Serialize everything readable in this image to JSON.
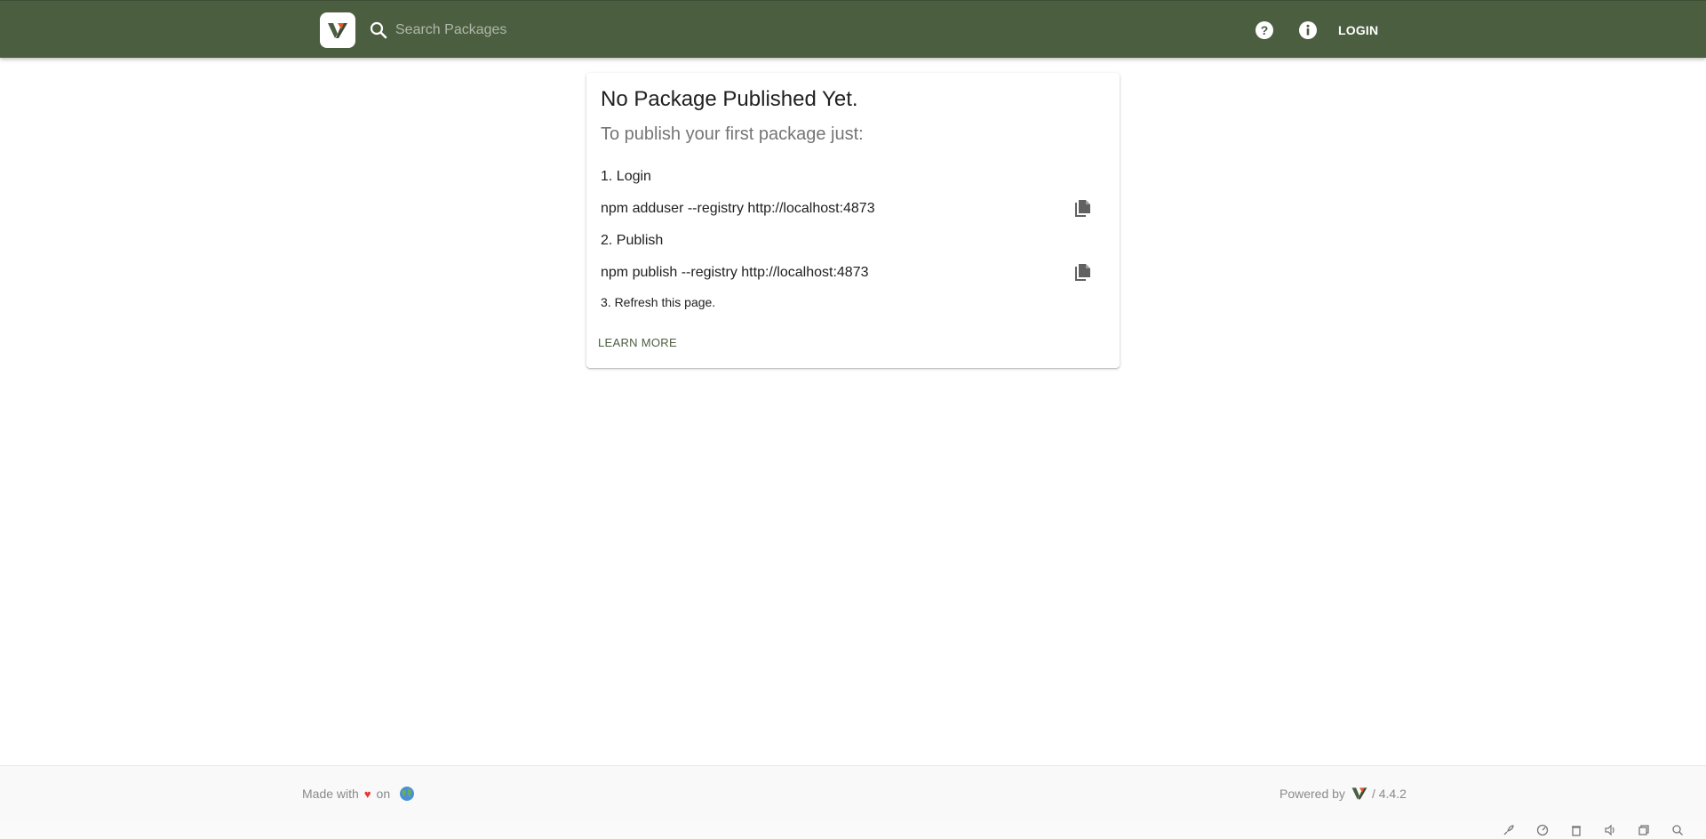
{
  "header": {
    "search_placeholder": "Search Packages",
    "login_label": "LOGIN",
    "icons": [
      "logo",
      "search-icon",
      "help-icon",
      "info-icon"
    ]
  },
  "card": {
    "title": "No Package Published Yet.",
    "subtitle": "To publish your first package just:",
    "step1": "1. Login",
    "cmd1": "npm adduser --registry http://localhost:4873",
    "step2": "2. Publish",
    "cmd2": "npm publish --registry http://localhost:4873",
    "step3": "3. Refresh this page.",
    "learn_more": "LEARN MORE"
  },
  "footer": {
    "made_with": "Made with",
    "heart": "♥",
    "on": "on",
    "powered_by": "Powered by",
    "version": "/ 4.4.2"
  },
  "colors": {
    "primary": "#4b5e40",
    "accent": "#e8572a"
  }
}
